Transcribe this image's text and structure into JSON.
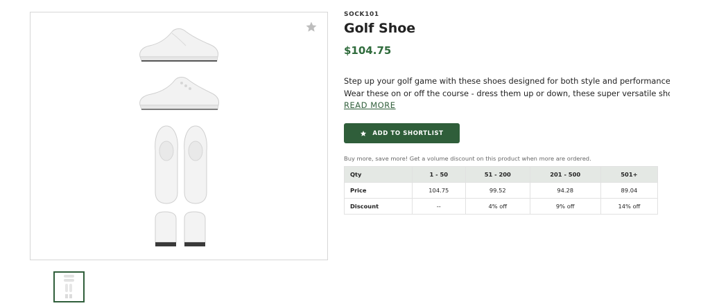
{
  "product": {
    "sku": "SOCK101",
    "title": "Golf Shoe",
    "price": "$104.75",
    "description_line1": "Step up your golf game with these shoes designed for both style and performance!",
    "description_line2": "Wear these on or off the course - dress them up or down, these super versatile shoe...",
    "read_more": "READ MORE",
    "shortlist_label": "ADD TO SHORTLIST",
    "volume_note": "Buy more, save more! Get a volume discount on this product when more are ordered."
  },
  "gallery": {
    "favorite_icon": "star-icon",
    "thumbnail_count": 1
  },
  "pricing_table": {
    "headers": [
      "Qty",
      "1 - 50",
      "51 - 200",
      "201 - 500",
      "501+"
    ],
    "rows": [
      [
        "Price",
        "104.75",
        "99.52",
        "94.28",
        "89.04"
      ],
      [
        "Discount",
        "--",
        "4% off",
        "9% off",
        "14% off"
      ]
    ]
  },
  "colors": {
    "brand_green": "#2f5e3a",
    "price_green": "#2f6b3c",
    "table_header_bg": "#e4e8e4"
  }
}
